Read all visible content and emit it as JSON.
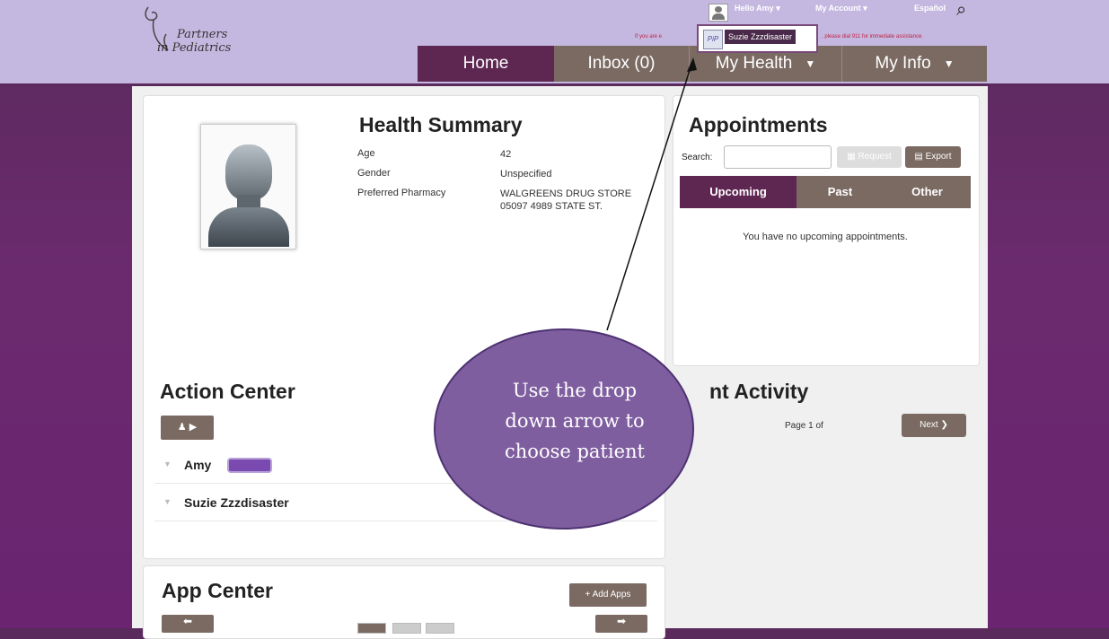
{
  "header": {
    "logo_line1": "Partners",
    "logo_line2": "in Pediatrics",
    "greeting": "Hello Amy",
    "my_account": "My Account",
    "language": "Español",
    "emergency_left": "If you are e",
    "emergency_right": ", please dial 911 for immediate assistance.",
    "patient_popup": "Suzie Zzzdisaster",
    "patient_popup_icon": "PiP",
    "nav": {
      "home": "Home",
      "inbox": "Inbox (0)",
      "my_health": "My Health",
      "my_info": "My Info"
    }
  },
  "health_summary": {
    "title": "Health Summary",
    "rows": [
      {
        "label": "Age",
        "value": "42"
      },
      {
        "label": "Gender",
        "value": "Unspecified"
      },
      {
        "label": "Preferred Pharmacy",
        "value": "WALGREENS DRUG STORE 05097 4989 STATE ST."
      }
    ]
  },
  "appointments": {
    "title": "Appointments",
    "search_label": "Search:",
    "request_label": "Request",
    "export_label": "Export",
    "tabs": [
      "Upcoming",
      "Past",
      "Other"
    ],
    "empty_message": "You have no upcoming appointments."
  },
  "action_center": {
    "title": "Action Center",
    "patients": [
      "Amy",
      "Suzie Zzzdisaster"
    ]
  },
  "recent_activity": {
    "title_visible": "nt Activity",
    "page_text": "Page 1 of",
    "next_label": "Next"
  },
  "app_center": {
    "title": "App Center",
    "add_apps_label": "+ Add Apps"
  },
  "callout": {
    "text": "Use the drop down arrow to choose patient"
  },
  "colors": {
    "header_bg": "#c5b8e0",
    "nav_active": "#5e2752",
    "nav_inactive": "#7a6a62",
    "page_bg": "#6b2a6e",
    "callout_fill": "#7f5ea0"
  }
}
